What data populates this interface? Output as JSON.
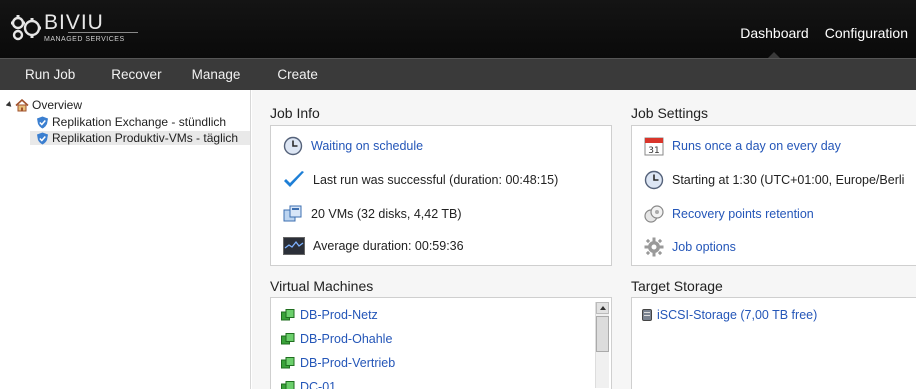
{
  "brand": {
    "name": "BIVIU",
    "subtitle": "MANAGED SERVICES"
  },
  "topnav": [
    {
      "label": "Dashboard"
    },
    {
      "label": "Configuration"
    }
  ],
  "toolbar": [
    {
      "label": "Run Job"
    },
    {
      "label": "Recover"
    },
    {
      "label": "Manage"
    },
    {
      "label": "Create"
    }
  ],
  "tree": {
    "root": "Overview",
    "children": [
      {
        "label": "Replikation Exchange - stündlich"
      },
      {
        "label": "Replikation Produktiv-VMs - täglich",
        "selected": true
      }
    ]
  },
  "job_info": {
    "title": "Job Info",
    "items": [
      {
        "icon": "clock-icon",
        "text": "Waiting on schedule"
      },
      {
        "icon": "checkmark-icon",
        "text": "Last run was successful (duration: 00:48:15)"
      },
      {
        "icon": "vms-icon",
        "text": "20 VMs (32 disks, 4,42 TB)"
      },
      {
        "icon": "duration-chart-icon",
        "text": "Average duration: 00:59:36"
      }
    ]
  },
  "job_settings": {
    "title": "Job Settings",
    "items": [
      {
        "icon": "calendar-icon",
        "calendar_day": "31",
        "text": "Runs once a day on every day"
      },
      {
        "icon": "clock-icon",
        "text": "Starting at 1:30 (UTC+01:00, Europe/Berli"
      },
      {
        "icon": "recovery-points-icon",
        "text": "Recovery points retention"
      },
      {
        "icon": "gear-icon",
        "text": "Job options"
      }
    ]
  },
  "virtual_machines": {
    "title": "Virtual Machines",
    "items": [
      {
        "label": "DB-Prod-Netz"
      },
      {
        "label": "DB-Prod-Ohahle"
      },
      {
        "label": "DB-Prod-Vertrieb"
      },
      {
        "label": "DC-01"
      }
    ]
  },
  "target_storage": {
    "title": "Target Storage",
    "items": [
      {
        "label": "iSCSI-Storage (7,00 TB free)"
      }
    ]
  },
  "colors": {
    "header_bg": "#111111",
    "toolbar_bg": "#3a3a3a",
    "link": "#2456b8",
    "check": "#1e7fd6",
    "vm_green": "#3aa23a"
  }
}
